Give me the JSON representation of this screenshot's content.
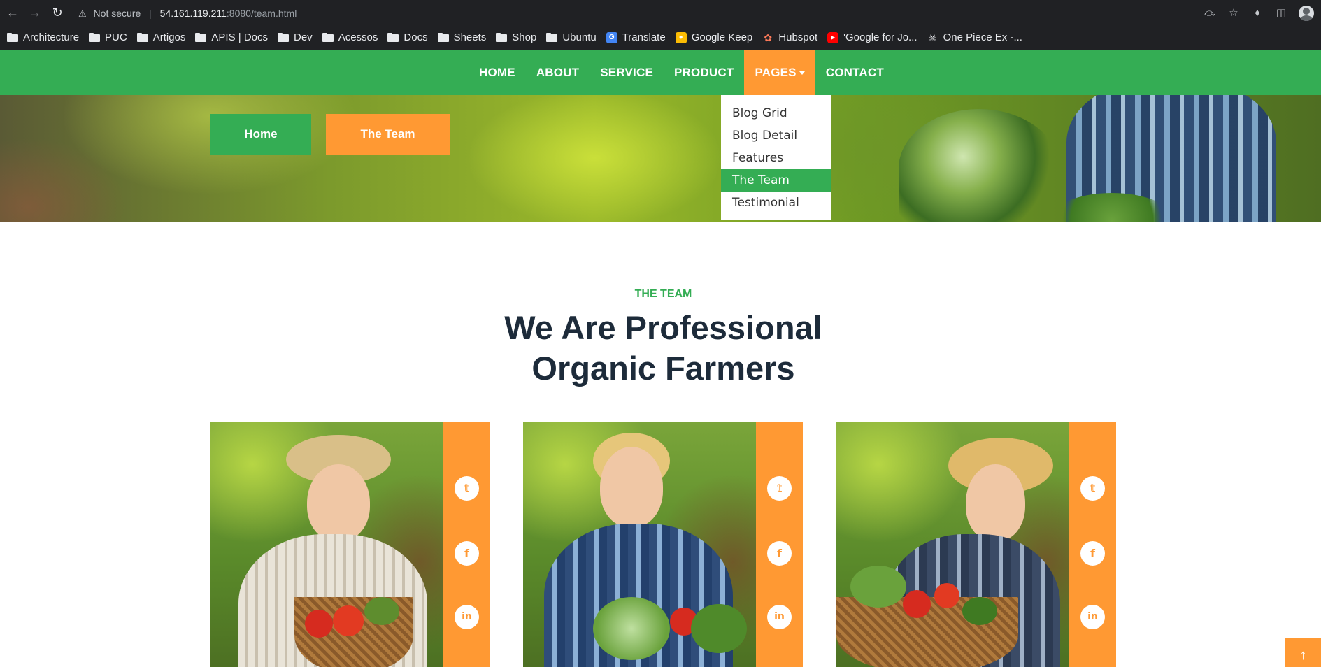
{
  "browser": {
    "not_secure": "Not secure",
    "url_host": "54.161.119.211",
    "url_path": ":8080/team.html",
    "bookmarks": [
      {
        "label": "Architecture",
        "icon": "folder-icon"
      },
      {
        "label": "PUC",
        "icon": "folder-icon"
      },
      {
        "label": "Artigos",
        "icon": "folder-icon"
      },
      {
        "label": "APIS | Docs",
        "icon": "folder-icon"
      },
      {
        "label": "Dev",
        "icon": "folder-icon"
      },
      {
        "label": "Acessos",
        "icon": "folder-icon"
      },
      {
        "label": "Docs",
        "icon": "folder-icon"
      },
      {
        "label": "Sheets",
        "icon": "folder-icon"
      },
      {
        "label": "Shop",
        "icon": "folder-icon"
      },
      {
        "label": "Ubuntu",
        "icon": "folder-icon"
      },
      {
        "label": "Translate",
        "icon": "google-translate-icon"
      },
      {
        "label": "Google Keep",
        "icon": "google-keep-icon"
      },
      {
        "label": "Hubspot",
        "icon": "hubspot-icon"
      },
      {
        "label": "'Google for Jo...",
        "icon": "youtube-icon"
      },
      {
        "label": "One Piece Ex -...",
        "icon": "one-piece-icon"
      }
    ]
  },
  "nav": {
    "items": [
      "HOME",
      "ABOUT",
      "SERVICE",
      "PRODUCT",
      "PAGES",
      "CONTACT"
    ],
    "active": "PAGES",
    "dropdown": [
      "Blog Grid",
      "Blog Detail",
      "Features",
      "The Team",
      "Testimonial"
    ],
    "dropdown_active": "The Team"
  },
  "breadcrumb": {
    "home": "Home",
    "current": "The Team"
  },
  "section": {
    "tag": "THE TEAM",
    "title_line1": "We Are Professional",
    "title_line2": "Organic Farmers"
  },
  "team": [
    {
      "photo": "older-farmer-with-basket",
      "social": {
        "twitter": "twitter-icon",
        "facebook": "facebook-icon",
        "linkedin": "linkedin-icon"
      }
    },
    {
      "photo": "woman-farmer-with-vegetables",
      "social": {
        "twitter": "twitter-icon",
        "facebook": "facebook-icon",
        "linkedin": "linkedin-icon"
      }
    },
    {
      "photo": "young-farmer-with-basket",
      "social": {
        "twitter": "twitter-icon",
        "facebook": "facebook-icon",
        "linkedin": "linkedin-icon"
      }
    }
  ],
  "colors": {
    "primary_green": "#34ad54",
    "accent_orange": "#ff9933",
    "heading_navy": "#1d2b3a"
  }
}
